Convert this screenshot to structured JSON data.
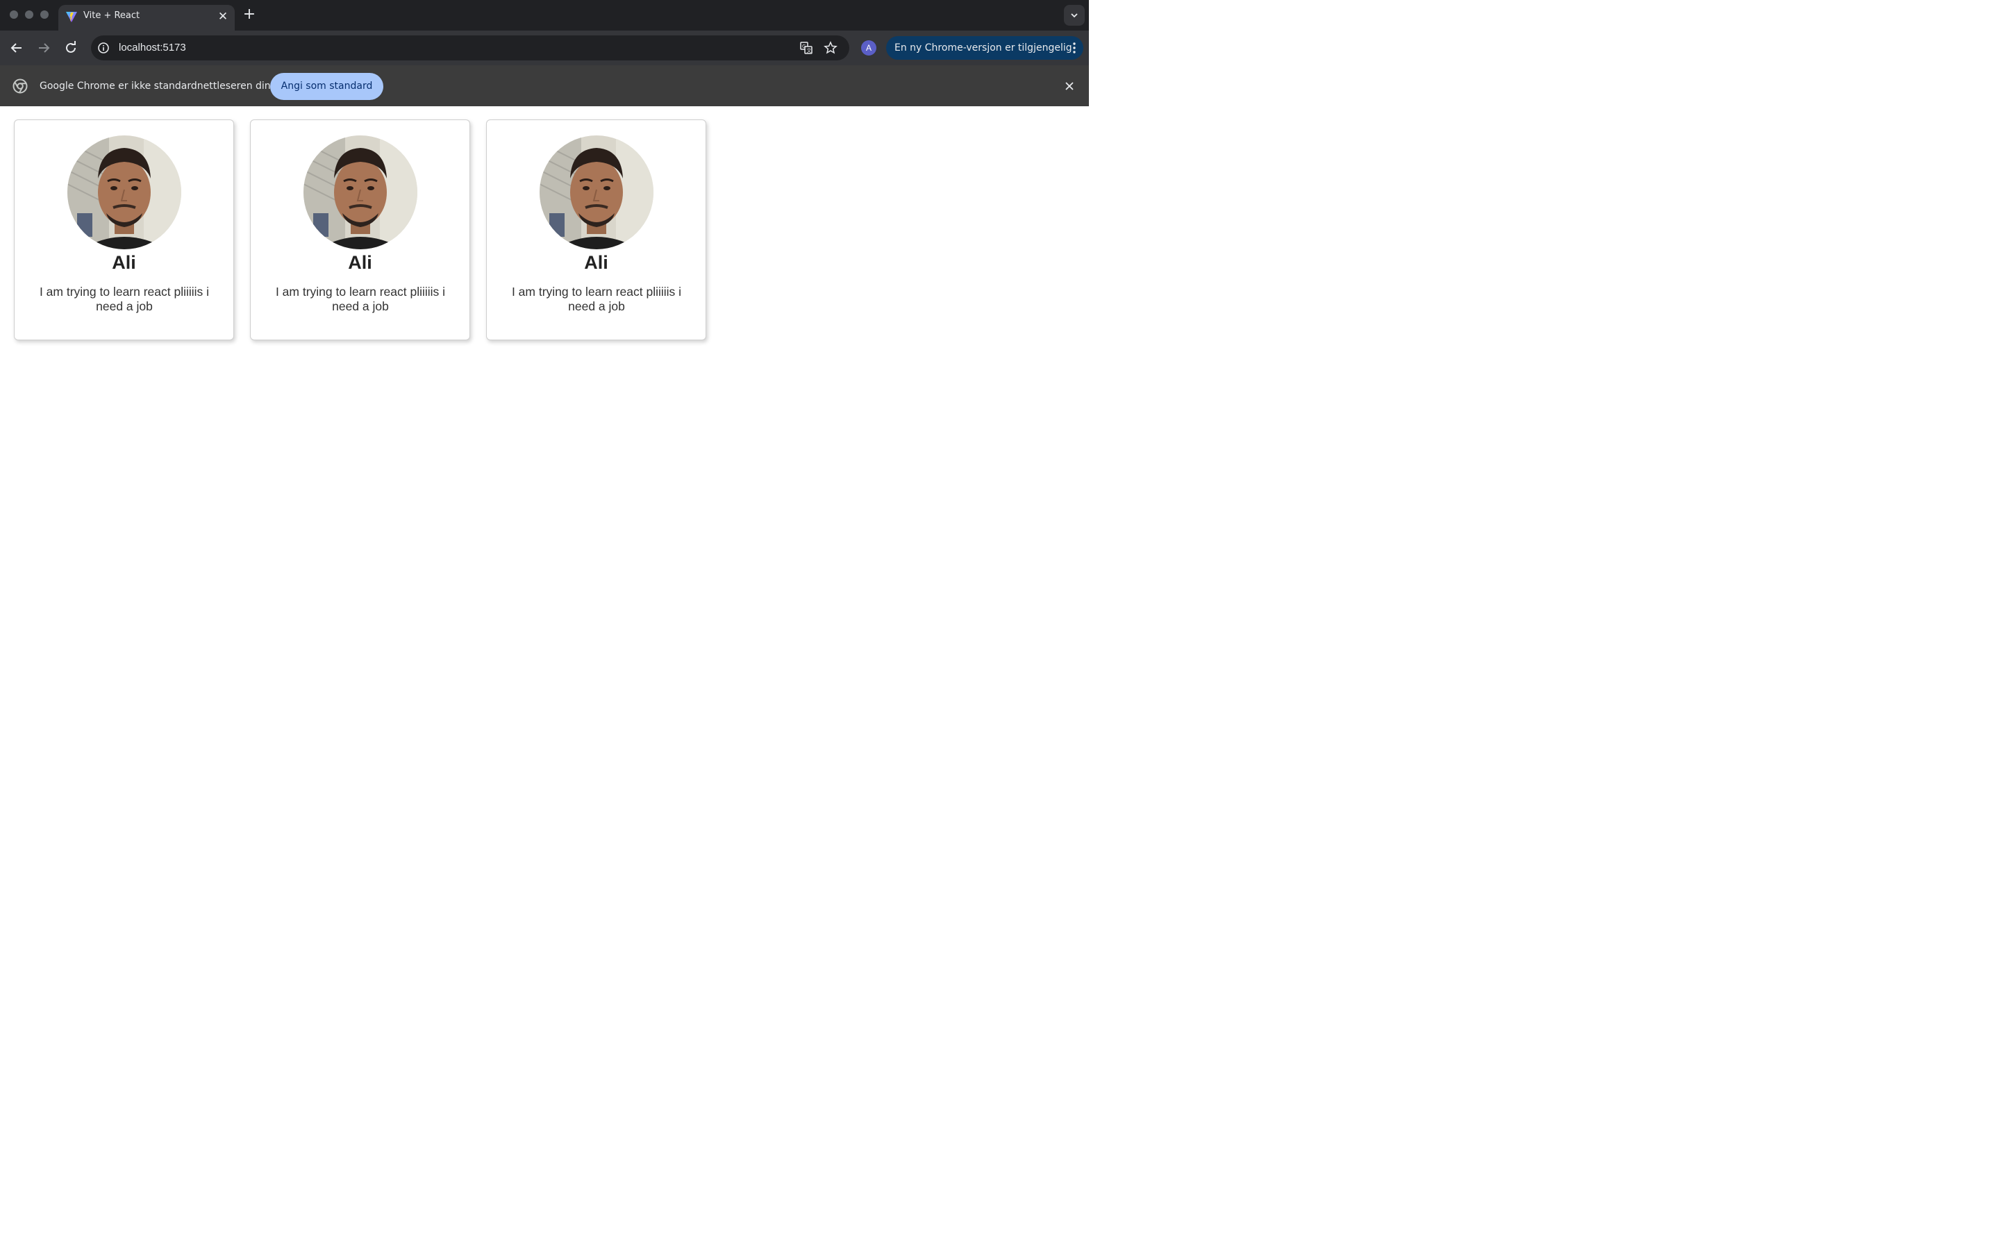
{
  "browser": {
    "tab": {
      "title": "Vite + React"
    },
    "address_bar": {
      "url": "localhost:5173"
    },
    "profile": {
      "initial": "A"
    },
    "update_notice": {
      "label": "En ny Chrome-versjon er tilgjengelig"
    },
    "infobar": {
      "message": "Google Chrome er ikke standardnettleseren din",
      "button_label": "Angi som standard"
    },
    "icons": [
      "back-arrow-icon",
      "forward-arrow-icon",
      "reload-icon",
      "info-icon",
      "translate-icon",
      "star-icon",
      "more-vert-icon",
      "chrome-icon",
      "close-icon",
      "chevron-down-icon"
    ]
  },
  "cards": [
    {
      "name": "Ali",
      "bio": "I am trying to learn react pliiiiis i need a job"
    },
    {
      "name": "Ali",
      "bio": "I am trying to learn react pliiiiis i need a job"
    },
    {
      "name": "Ali",
      "bio": "I am trying to learn react pliiiiis i need a job"
    }
  ]
}
